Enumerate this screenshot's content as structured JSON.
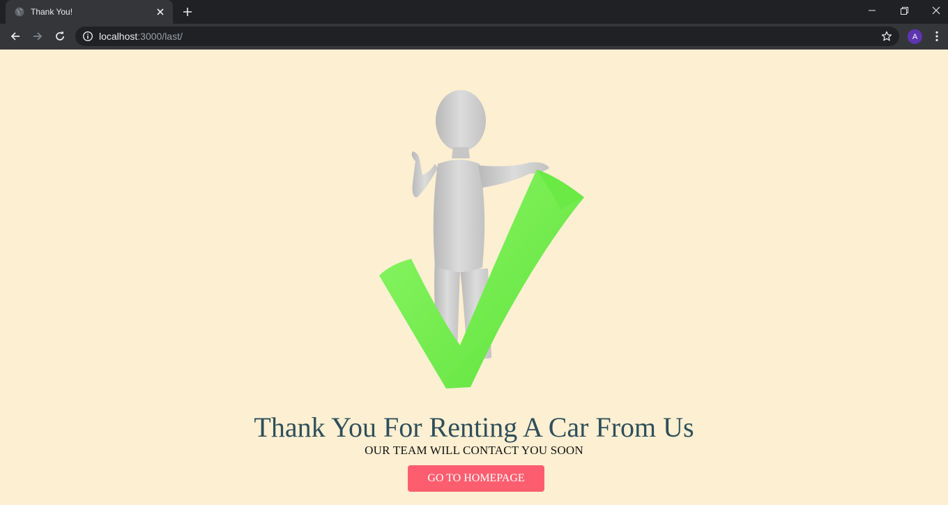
{
  "browser": {
    "tab_title": "Thank You!",
    "url_host": "localhost",
    "url_path": ":3000/last/",
    "profile_initial": "A",
    "profile_color": "#5e35b1"
  },
  "page": {
    "background": "#fcefd2",
    "hero_image": "person-with-green-checkmark",
    "headline": "Thank You For Renting A Car From Us",
    "subline": "OUR TEAM WILL CONTACT YOU SOON",
    "button_label": "GO TO HOMEPAGE",
    "button_color": "#fd5e6f"
  }
}
